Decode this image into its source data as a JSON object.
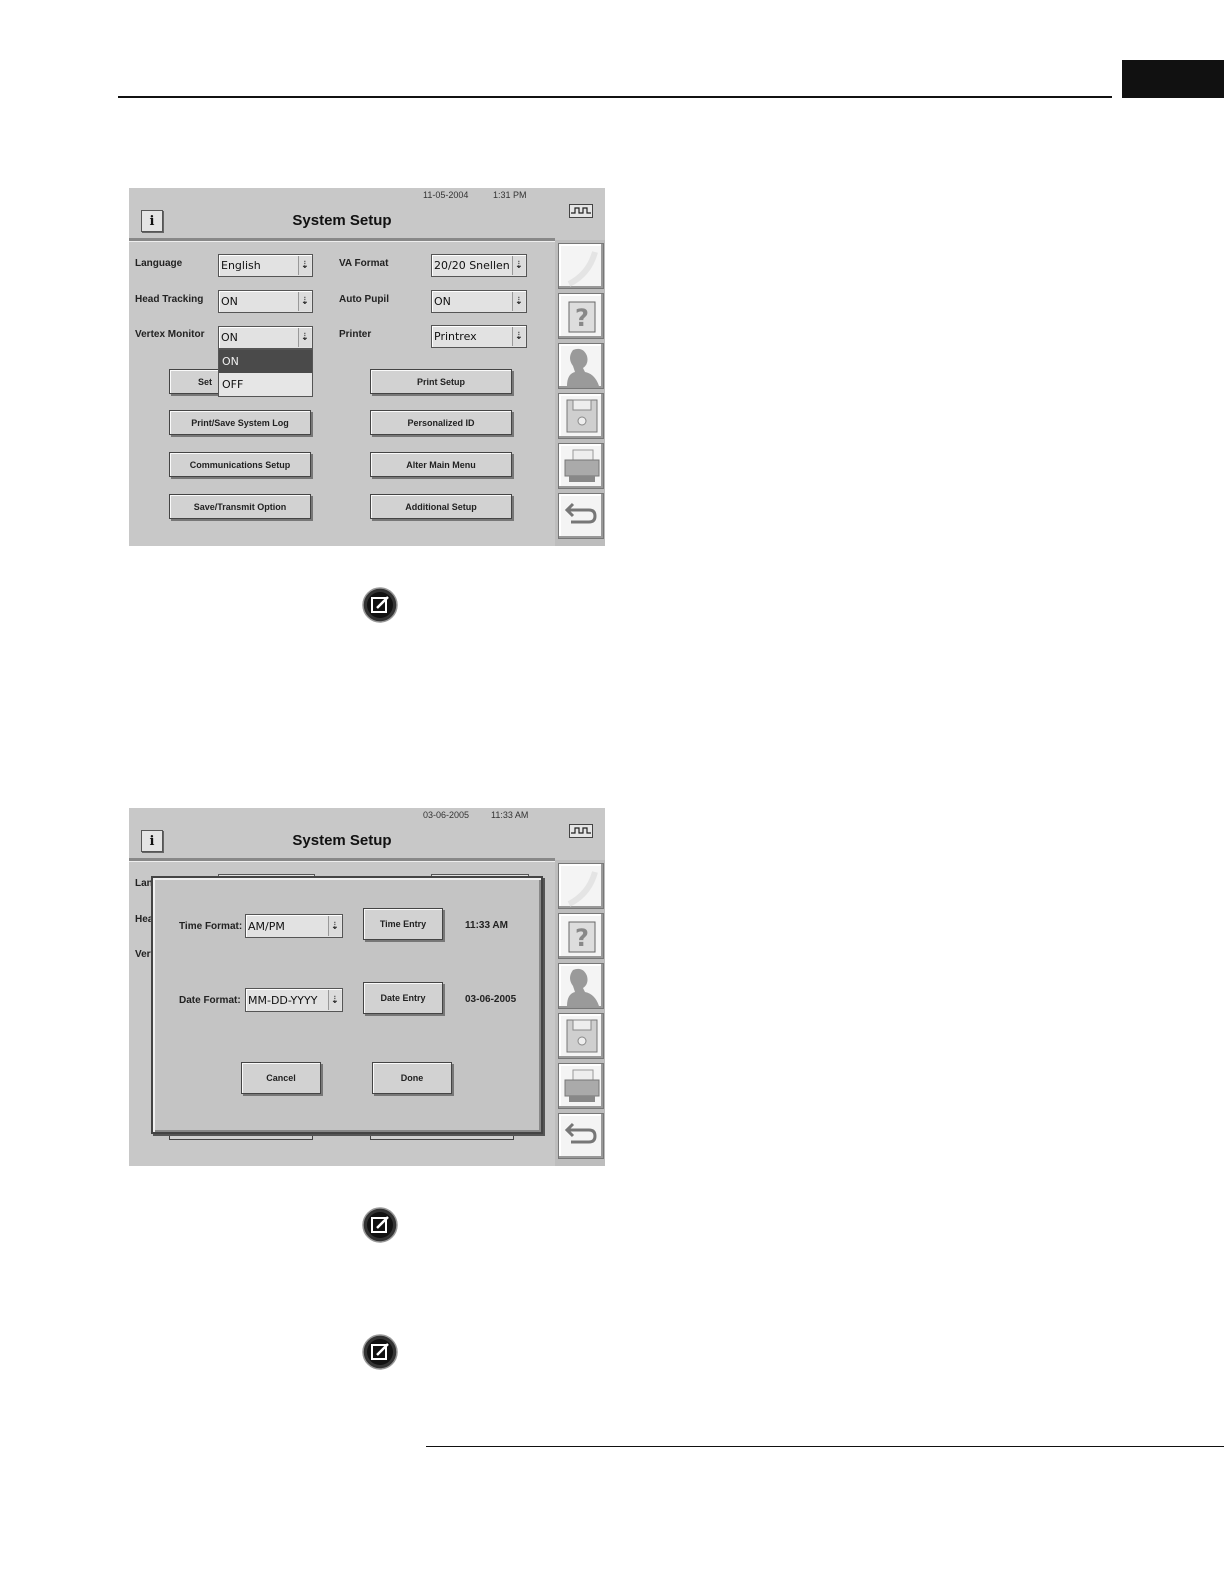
{
  "screen1": {
    "date": "11-05-2004",
    "time": "1:31 PM",
    "title": "System Setup",
    "info_glyph": "i",
    "fields": {
      "language": {
        "label": "Language",
        "value": "English"
      },
      "head_tracking": {
        "label": "Head Tracking",
        "value": "ON"
      },
      "vertex_monitor": {
        "label": "Vertex Monitor",
        "value": "ON"
      },
      "va_format": {
        "label": "VA Format",
        "value": "20/20 Snellen"
      },
      "auto_pupil": {
        "label": "Auto Pupil",
        "value": "ON"
      },
      "printer": {
        "label": "Printer",
        "value": "Printrex"
      }
    },
    "dropdown_options": [
      "ON",
      "OFF"
    ],
    "buttons": {
      "set": "Set",
      "print_setup": "Print Setup",
      "print_save_log": "Print/Save System Log",
      "personalized_id": "Personalized ID",
      "communications_setup": "Communications Setup",
      "alter_main_menu": "Alter Main Menu",
      "save_transmit_option": "Save/Transmit Option",
      "additional_setup": "Additional Setup"
    }
  },
  "screen2": {
    "date": "03-06-2005",
    "time": "11:33 AM",
    "title": "System Setup",
    "info_glyph": "i",
    "partial_labels": {
      "language": "Lang",
      "head": "Hea",
      "vertex": "Vert"
    },
    "dialog": {
      "time_format_label": "Time Format:",
      "time_format_value": "AM/PM",
      "time_entry_button": "Time Entry",
      "time_value": "11:33 AM",
      "date_format_label": "Date Format:",
      "date_format_value": "MM-DD-YYYY",
      "date_entry_button": "Date Entry",
      "date_value": "03-06-2005",
      "cancel_button": "Cancel",
      "done_button": "Done"
    }
  },
  "sidebar_icons": [
    "blank-icon",
    "help-icon",
    "patient-icon",
    "disk-icon",
    "printer-icon",
    "return-icon"
  ],
  "arrow_glyph": "⇣"
}
